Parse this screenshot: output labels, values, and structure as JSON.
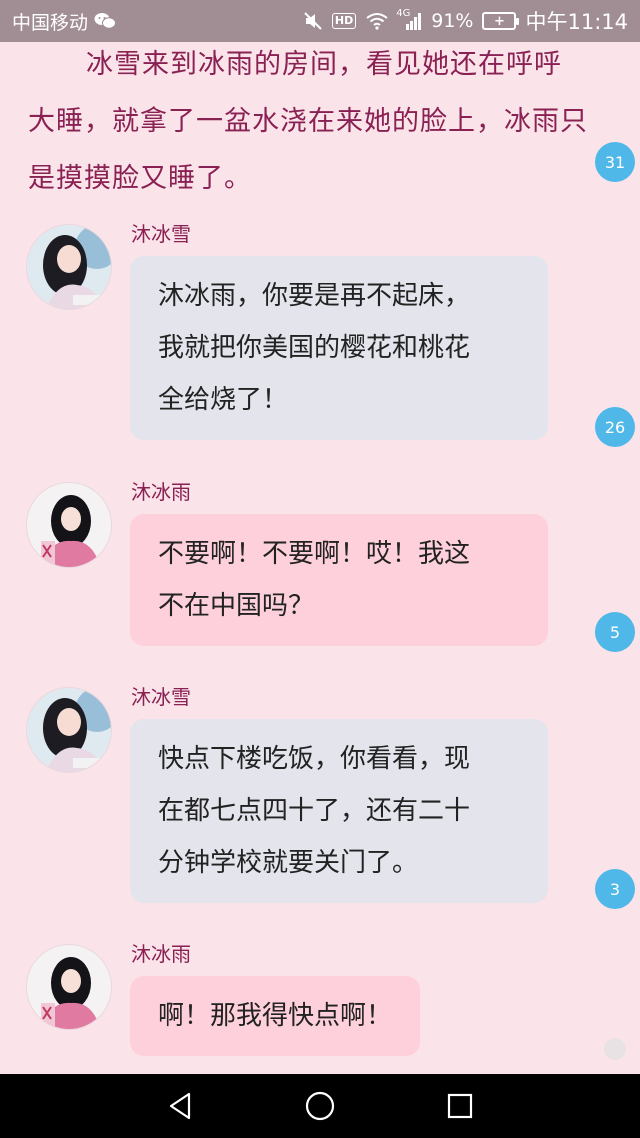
{
  "status_bar": {
    "carrier": "中国移动",
    "network": "4G",
    "hd": "HD",
    "battery_percent": "91%",
    "time": "中午11:14"
  },
  "narration": "冰雪来到冰雨的房间，看见她还在呼呼大睡，就拿了一盆水浇在来她的脸上，冰雨只是摸摸脸又睡了。",
  "messages": [
    {
      "sender": "沐冰雪",
      "lines": [
        "沐冰雨，你要是再不起床，",
        "我就把你美国的樱花和桃花",
        "全给烧了！"
      ]
    },
    {
      "sender": "沐冰雨",
      "lines": [
        "不要啊！不要啊！哎！我这",
        "不在中国吗？"
      ]
    },
    {
      "sender": "沐冰雪",
      "lines": [
        "快点下楼吃饭，你看看，现",
        "在都七点四十了，还有二十",
        "分钟学校就要关门了。"
      ]
    },
    {
      "sender": "沐冰雨",
      "lines": [
        "啊！那我得快点啊！"
      ]
    }
  ],
  "comment_counts": [
    "31",
    "26",
    "5",
    "3"
  ],
  "colors": {
    "background": "#fbe3ea",
    "narration_text": "#8a2153",
    "bubble_xue": "#e3e4ec",
    "bubble_yu": "#fdd0db",
    "badge": "#4fb8e8"
  },
  "icons": {
    "wechat": "wechat-icon",
    "mute": "mute-icon",
    "wifi": "wifi-icon",
    "signal": "signal-icon",
    "battery": "battery-icon",
    "nav_back": "back-triangle-icon",
    "nav_home": "home-circle-icon",
    "nav_recent": "recent-square-icon"
  }
}
